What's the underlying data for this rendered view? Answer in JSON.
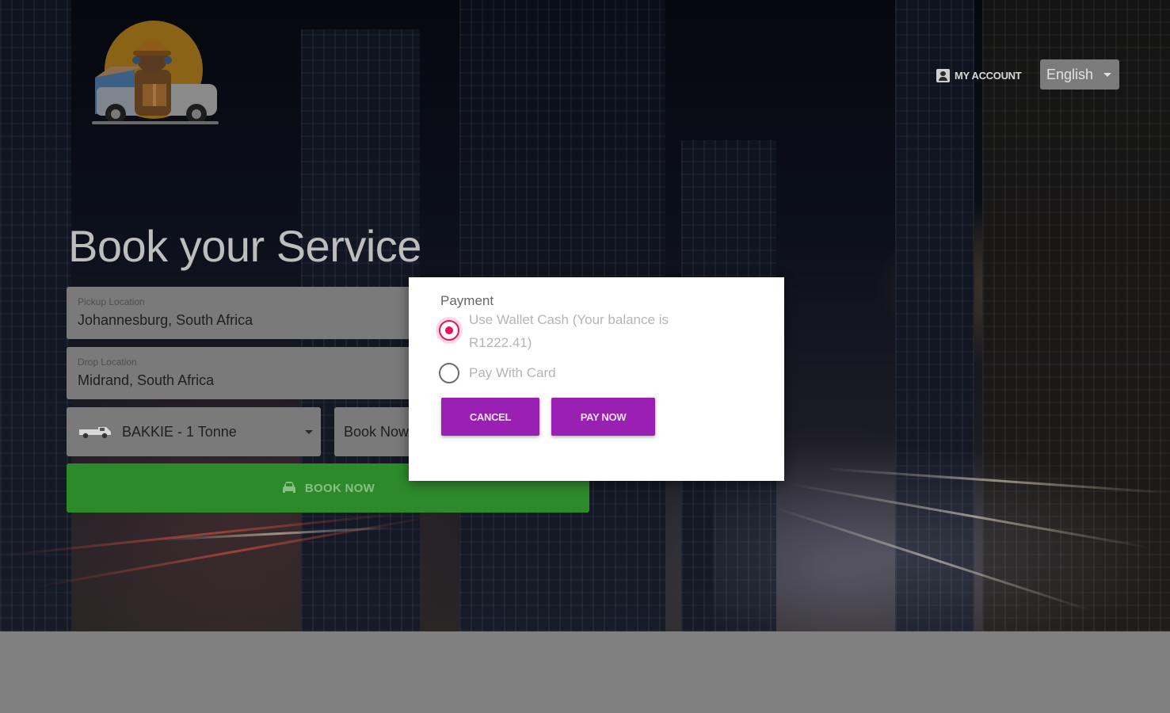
{
  "header": {
    "my_account_label": "MY ACCOUNT",
    "language_selected": "English"
  },
  "booking": {
    "title": "Book your Service",
    "pickup": {
      "label": "Pickup Location",
      "value": "Johannesburg, South Africa"
    },
    "drop": {
      "label": "Drop Location",
      "value": "Midrand, South Africa"
    },
    "vehicle": {
      "selected": "BAKKIE - 1 Tonne",
      "icon": "truck-icon"
    },
    "booking_type": "Book Now",
    "book_now_label": "BOOK NOW",
    "book_now_icon": "car-icon"
  },
  "payment_modal": {
    "heading": "Payment",
    "options": [
      {
        "label": "Use Wallet Cash (Your balance is R1222.41)",
        "selected": true
      },
      {
        "label": "Pay With Card",
        "selected": false
      }
    ],
    "cancel_label": "CANCEL",
    "pay_now_label": "PAY NOW"
  },
  "colors": {
    "book_button": "#2d8a2b",
    "modal_button": "#9a1fb3",
    "radio_selected": "#e9135a",
    "overlay_footer": "#808080"
  }
}
